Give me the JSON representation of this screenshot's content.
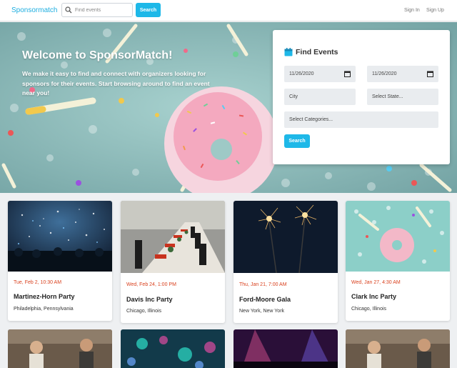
{
  "navbar": {
    "brand": "Sponsormatch",
    "search_placeholder": "Find events",
    "search_button": "Search",
    "sign_in": "Sign In",
    "sign_up": "Sign Up"
  },
  "hero": {
    "title": "Welcome to SponsorMatch!",
    "text": "We make it easy to find and connect with organizers looking for sponsors for their events. Start browsing around to find an event near you!"
  },
  "find_events": {
    "title": "Find Events",
    "start_date": "11/26/2020",
    "end_date": "11/26/2020",
    "city_placeholder": "City",
    "state_placeholder": "Select State...",
    "categories_placeholder": "Select Categories...",
    "search_button": "Search"
  },
  "events": [
    {
      "date": "Tue, Feb 2, 10:30 AM",
      "title": "Martinez-Horn Party",
      "location": "Philadelphia, Pennsylvania",
      "image": "concert-confetti"
    },
    {
      "date": "Wed, Feb 24, 1:00 PM",
      "title": "Davis Inc Party",
      "location": "Chicago, Illinois",
      "image": "banquet-table"
    },
    {
      "date": "Thu, Jan 21, 7:00 AM",
      "title": "Ford-Moore Gala",
      "location": "New York, New York",
      "image": "sparklers"
    },
    {
      "date": "Wed, Jan 27, 4:30 AM",
      "title": "Clark Inc Party",
      "location": "Chicago, Illinois",
      "image": "party-donut"
    }
  ],
  "colors": {
    "brand": "#1eaee0",
    "button": "#1eb8e8",
    "date_text": "#d9411e"
  }
}
